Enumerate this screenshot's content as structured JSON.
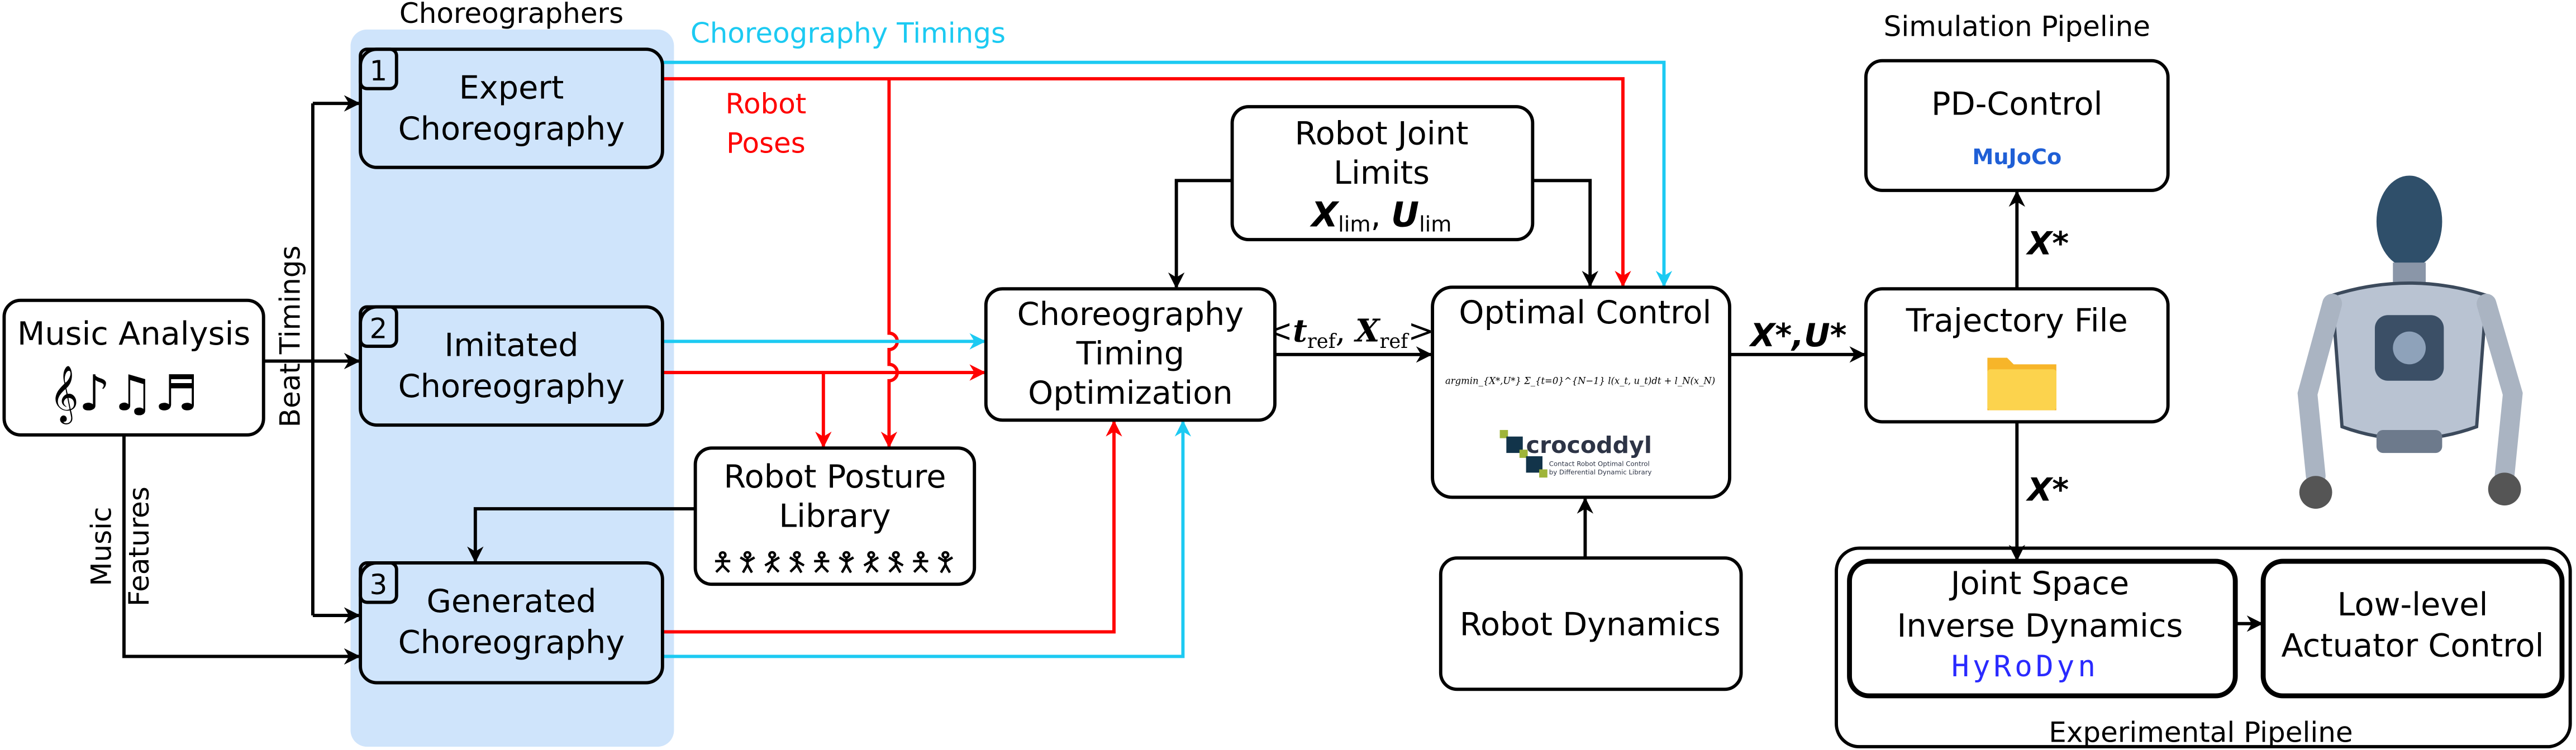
{
  "colors": {
    "choreographers_bg": "#cfe4fb",
    "timings": "#1ccaf2",
    "poses": "#ff0000",
    "mujoco": "#1f5fd6",
    "hyrodyn": "#2a2aff",
    "folder": "#fcd34d"
  },
  "labels": {
    "choreographers": "Choreographers",
    "choreography_timings": "Choreography Timings",
    "robot_poses_1": "Robot",
    "robot_poses_2": "Poses",
    "beat_timings": "Beat Timings",
    "music_features_1": "Music",
    "music_features_2": "Features",
    "simulation_pipeline": "Simulation Pipeline",
    "experimental_pipeline": "Experimental Pipeline",
    "t_ref_x_ref": "<t_ref, X_ref>",
    "x_star_u_star": "X*,U*",
    "x_star_top": "X*",
    "x_star_bottom": "X*",
    "u": "U"
  },
  "boxes": {
    "music_analysis": {
      "title": "Music Analysis",
      "icon": "music-notes-icon"
    },
    "expert": {
      "num": "1",
      "line1": "Expert",
      "line2": "Choreography"
    },
    "imitated": {
      "num": "2",
      "line1": "Imitated",
      "line2": "Choreography"
    },
    "generated": {
      "num": "3",
      "line1": "Generated",
      "line2": "Choreography"
    },
    "posture_library": {
      "line1": "Robot Posture",
      "line2": "Library",
      "icon": "dance-poses-icon"
    },
    "timing_opt": {
      "line1": "Choreography",
      "line2": "Timing",
      "line3": "Optimization"
    },
    "joint_limits": {
      "line1": "Robot Joint",
      "line2": "Limits",
      "formula": "X_lim, U_lim"
    },
    "optimal_control": {
      "title": "Optimal Control",
      "formula": "argmin_{X*,U*} Σ_{t=0}^{N−1} l(x_t, u_t)dt + l_N(x_N)",
      "logo": "crocoddyl",
      "logo_sub1": "Contact Robot Optimal Control",
      "logo_sub2": "by Differential Dynamic Library"
    },
    "robot_dynamics": {
      "title": "Robot Dynamics"
    },
    "pd_control": {
      "title": "PD-Control",
      "logo": "MuJoCo"
    },
    "trajectory_file": {
      "title": "Trajectory File",
      "icon": "folder-icon"
    },
    "inverse_dynamics": {
      "line1": "Joint Space",
      "line2": "Inverse Dynamics",
      "logo": "HyRoDyn"
    },
    "actuator_control": {
      "line1": "Low-level",
      "line2": "Actuator Control"
    }
  }
}
